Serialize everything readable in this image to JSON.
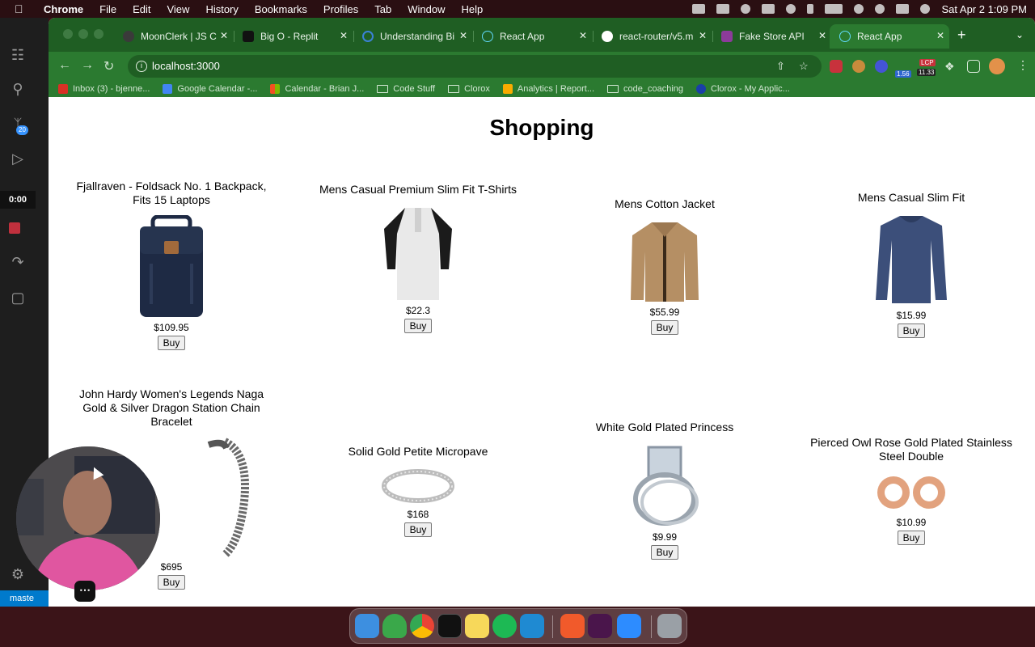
{
  "menubar": {
    "app_name": "Chrome",
    "items": [
      "File",
      "Edit",
      "View",
      "History",
      "Bookmarks",
      "Profiles",
      "Tab",
      "Window",
      "Help"
    ],
    "clock": "Sat Apr 2  1:09 PM"
  },
  "vscode": {
    "source_control_badge": "20",
    "recording_timer": "0:00",
    "branch": "maste"
  },
  "tabs": [
    {
      "label": "MoonClerk | JS C",
      "favicon_color": "#3a3a3a"
    },
    {
      "label": "Big O - Replit",
      "favicon_color": "#222222"
    },
    {
      "label": "Understanding Bi",
      "favicon_color": "#3b82d6"
    },
    {
      "label": "React App",
      "favicon_color": "#61dafb"
    },
    {
      "label": "react-router/v5.m",
      "favicon_color": "#ffffff"
    },
    {
      "label": "Fake Store API",
      "favicon_color": "#8c3b9a"
    },
    {
      "label": "React App",
      "favicon_color": "#61dafb",
      "active": true
    }
  ],
  "address_bar": {
    "url": "localhost:3000"
  },
  "extensions": {
    "badge_blue": "1.56",
    "badge_lcp": "LCP",
    "badge_lcp_value": "11.33"
  },
  "bookmarks": [
    {
      "label": "Inbox (3) - bjenne...",
      "icon": "gmail-icon",
      "color": "#d93025"
    },
    {
      "label": "Google Calendar -...",
      "icon": "calendar-icon",
      "color": "#4285f4"
    },
    {
      "label": "Calendar - Brian J...",
      "icon": "microsoft-icon",
      "color": "#f25022"
    },
    {
      "label": "Code Stuff",
      "icon": "folder-icon"
    },
    {
      "label": "Clorox",
      "icon": "folder-icon"
    },
    {
      "label": "Analytics | Report...",
      "icon": "analytics-icon",
      "color": "#f9ab00"
    },
    {
      "label": "code_coaching",
      "icon": "folder-icon"
    },
    {
      "label": "Clorox - My Applic...",
      "icon": "globe-icon",
      "color": "#1a3fa8"
    }
  ],
  "page": {
    "heading": "Shopping",
    "buy_label": "Buy",
    "products": [
      {
        "title": "Fjallraven - Foldsack No. 1 Backpack, Fits 15 Laptops",
        "price": "$109.95",
        "image": "backpack"
      },
      {
        "title": "Mens Casual Premium Slim Fit T-Shirts",
        "price": "$22.3",
        "image": "tshirt"
      },
      {
        "title": "Mens Cotton Jacket",
        "price": "$55.99",
        "image": "jacket"
      },
      {
        "title": "Mens Casual Slim Fit",
        "price": "$15.99",
        "image": "longsleeve"
      },
      {
        "title": "John Hardy Women's Legends Naga Gold & Silver Dragon Station Chain Bracelet",
        "price": "$695",
        "image": "bracelet"
      },
      {
        "title": "Solid Gold Petite Micropave",
        "price": "$168",
        "image": "ring"
      },
      {
        "title": "White Gold Plated Princess",
        "price": "$9.99",
        "image": "princess-ring"
      },
      {
        "title": "Pierced Owl Rose Gold Plated Stainless Steel Double",
        "price": "$10.99",
        "image": "plugs"
      }
    ]
  },
  "colors": {
    "chrome_frame": "#1f5e23",
    "chrome_toolbar": "#2b7a30",
    "desktop": "#3b1418"
  }
}
